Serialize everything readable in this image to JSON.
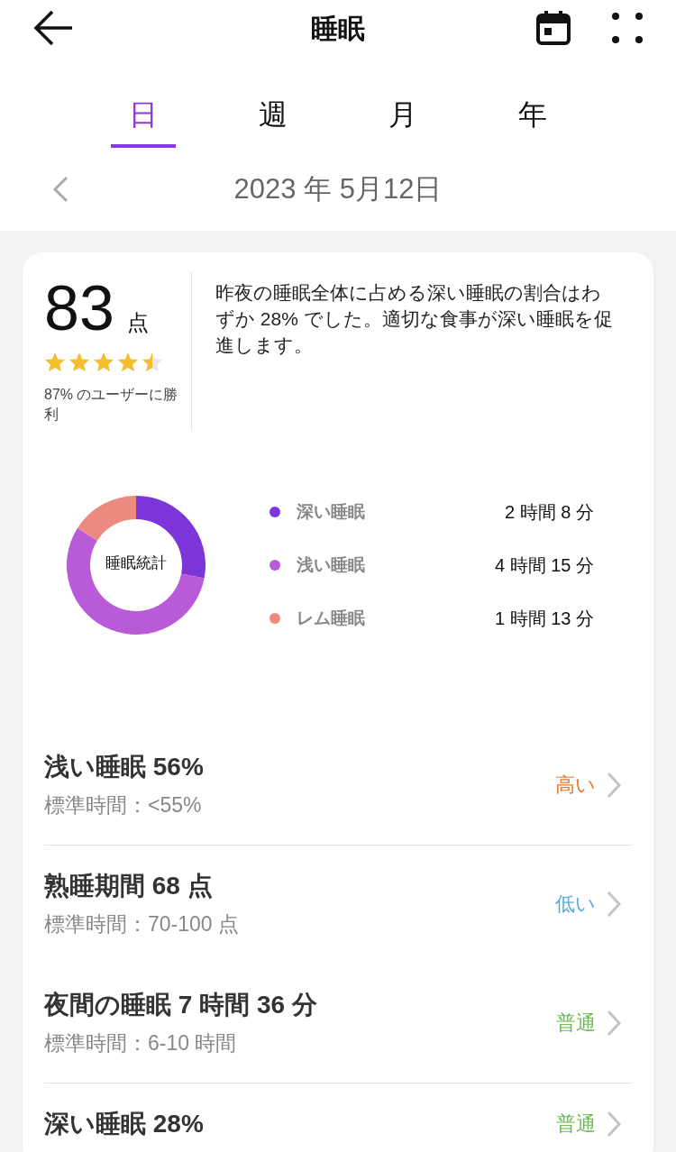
{
  "header": {
    "title": "睡眠"
  },
  "tabs": [
    {
      "label": "日",
      "selected": true
    },
    {
      "label": "週",
      "selected": false
    },
    {
      "label": "月",
      "selected": false
    },
    {
      "label": "年",
      "selected": false
    }
  ],
  "date": "2023 年 5月12日",
  "score": {
    "value": "83",
    "unit": "点",
    "stars": 4.5,
    "rank": "87% のユーザーに勝利",
    "advice": "昨夜の睡眠全体に占める深い睡眠の割合はわずか 28% でした。適切な食事が深い睡眠を促進します。"
  },
  "chart_data": {
    "type": "donut",
    "title": "睡眠統計",
    "categories": [
      "深い睡眠",
      "浅い睡眠",
      "レム睡眠"
    ],
    "values": [
      28,
      56,
      16
    ]
  },
  "legend": [
    {
      "value": "2 時間 8 分",
      "color": "#7b35d8"
    },
    {
      "value": "4 時間 15 分",
      "color": "#b95ad9"
    },
    {
      "value": "1 時間 13 分",
      "color": "#ec8a80"
    }
  ],
  "metrics": [
    {
      "title": "浅い睡眠 56%",
      "standard": "標準時間：<55%",
      "status": "高い",
      "color": "#e8792f",
      "divider_before": false
    },
    {
      "title": "熟睡期間 68 点",
      "standard": "標準時間：70-100 点",
      "status": "低い",
      "color": "#5aa9dd",
      "divider_before": true
    },
    {
      "title": "夜間の睡眠 7 時間 36 分",
      "standard": "標準時間：6-10 時間",
      "status": "普通",
      "color": "#6dbb4f",
      "divider_before": false
    },
    {
      "title": "深い睡眠 28%",
      "status": "普通",
      "color": "#6dbb4f",
      "divider_before": true
    }
  ]
}
